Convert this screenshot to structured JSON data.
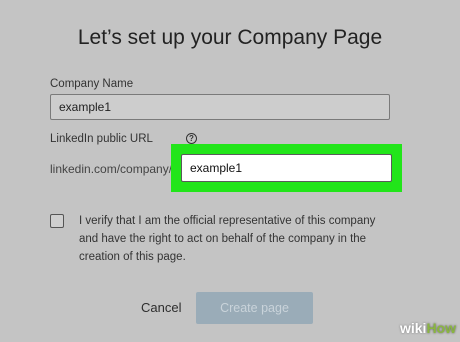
{
  "page": {
    "title": "Let’s set up your Company Page"
  },
  "form": {
    "company_name_label": "Company Name",
    "company_name_value": "example1",
    "url_label": "LinkedIn public URL",
    "url_prefix": "linkedin.com/company/",
    "url_value": "example1",
    "verify_text": "I verify that I am the official representative of this company and have the right to act on behalf of the company in the creation of this page.",
    "verify_checked": false
  },
  "actions": {
    "cancel_label": "Cancel",
    "create_label": "Create page"
  },
  "watermark": {
    "wiki": "wiki",
    "how": "How"
  },
  "colors": {
    "background": "#c4c4c4",
    "highlight": "#22e51a",
    "create_button": "#9aacb8",
    "watermark_how": "#8ab640"
  },
  "icons": {
    "help": "question-circle-icon"
  }
}
